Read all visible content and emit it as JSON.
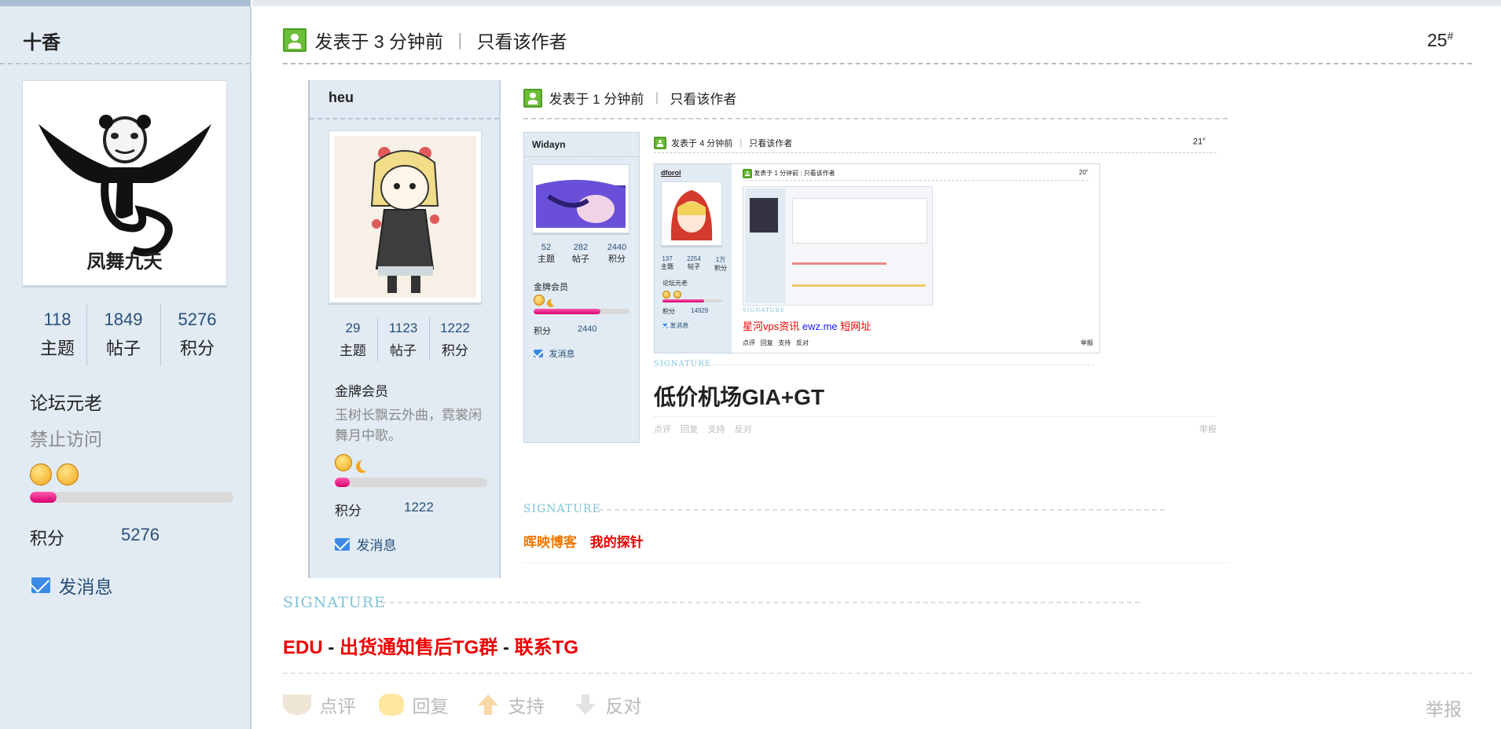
{
  "main_post": {
    "username": "十香",
    "avatar_text": "凤舞九天",
    "stats": [
      {
        "num": "118",
        "label": "主题"
      },
      {
        "num": "1849",
        "label": "帖子"
      },
      {
        "num": "5276",
        "label": "积分"
      }
    ],
    "rank": "论坛元老",
    "status": "禁止访问",
    "credit_label": "积分",
    "credit_value": "5276",
    "level_progress": 0.13,
    "message_label": "发消息",
    "posted": "发表于 3 分钟前",
    "only_author": "只看该作者",
    "floor": "25",
    "floor_mark": "#",
    "signature_label": "SIGNATURE",
    "signature": {
      "edu": "EDU",
      "sep1": " - ",
      "link1": "出货通知售后TG群",
      "sep2": " - ",
      "link2": "联系TG"
    },
    "actions": {
      "comment": "点评",
      "reply": "回复",
      "support": "支持",
      "oppose": "反对",
      "report": "举报"
    }
  },
  "quote1": {
    "username": "heu",
    "stats": [
      {
        "num": "29",
        "label": "主题"
      },
      {
        "num": "1123",
        "label": "帖子"
      },
      {
        "num": "1222",
        "label": "积分"
      }
    ],
    "rank": "金牌会员",
    "motto": "玉树长飘云外曲，霓裳闲舞月中歌。",
    "credit_label": "积分",
    "credit_value": "1222",
    "level_progress": 0.1,
    "message_label": "发消息",
    "posted": "发表于 1 分钟前",
    "only_author": "只看该作者",
    "signature_label": "SIGNATURE",
    "sig_link1": "晖映博客",
    "sig_link2": "我的探针"
  },
  "quote2": {
    "username": "Widayn",
    "stats": [
      {
        "num": "52",
        "label": "主题"
      },
      {
        "num": "282",
        "label": "帖子"
      },
      {
        "num": "2440",
        "label": "积分"
      }
    ],
    "rank": "金牌会员",
    "credit_label": "积分",
    "credit_value": "2440",
    "level_progress": 0.7,
    "message_label": "发消息",
    "posted": "发表于 4 分钟前",
    "only_author": "只看该作者",
    "floor": "21",
    "floor_mark": "#",
    "signature_label": "SIGNATURE",
    "headline": "低价机场GIA+GT",
    "actions": {
      "comment": "点评",
      "reply": "回复",
      "support": "支持",
      "oppose": "反对",
      "report": "举报"
    }
  },
  "quote3": {
    "username": "dforol",
    "stats": [
      {
        "num": "137",
        "label": "主题"
      },
      {
        "num": "2254",
        "label": "帖子"
      },
      {
        "num": "1万",
        "label": "积分"
      }
    ],
    "rank": "论坛元老",
    "credit_label": "积分",
    "credit_value": "14929",
    "message_label": "发消息",
    "posted": "发表于 1 分钟前",
    "only_author": "只看该作者",
    "floor": "20",
    "floor_mark": "#",
    "signature_label": "SIGNATURE",
    "sig_red": "星河vps资讯",
    "sig_blue": "ewz.me",
    "sig_red2": "短网址",
    "actions": {
      "comment": "点评",
      "reply": "回复",
      "support": "支持",
      "oppose": "反对",
      "report": "举报"
    }
  },
  "colors": {
    "sidebar_bg": "#e2ebf3",
    "link_blue": "#2a4f7a",
    "signature_red": "#e00000",
    "accent_green": "#6cbd3a"
  }
}
